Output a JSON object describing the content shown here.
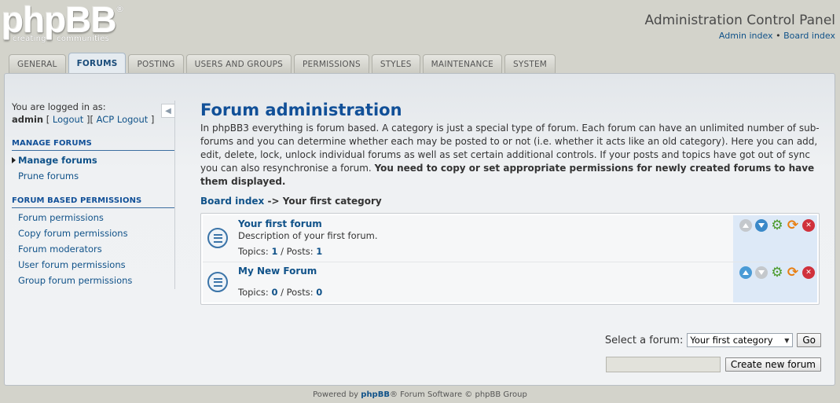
{
  "header": {
    "logo_text": "phpBB",
    "logo_reg": "®",
    "logo_tagline": "creating    communities",
    "title": "Administration Control Panel",
    "admin_index": "Admin index",
    "separator": "•",
    "board_index": "Board index"
  },
  "tabs": [
    {
      "label": "GENERAL",
      "active": false
    },
    {
      "label": "FORUMS",
      "active": true
    },
    {
      "label": "POSTING",
      "active": false
    },
    {
      "label": "USERS AND GROUPS",
      "active": false
    },
    {
      "label": "PERMISSIONS",
      "active": false
    },
    {
      "label": "STYLES",
      "active": false
    },
    {
      "label": "MAINTENANCE",
      "active": false
    },
    {
      "label": "SYSTEM",
      "active": false
    }
  ],
  "sidebar": {
    "logged_in_label": "You are logged in as:",
    "username": "admin",
    "logout": "Logout",
    "acp_logout": "ACP Logout",
    "collapse_icon": "collapse-left-icon",
    "sections": [
      {
        "heading": "MANAGE FORUMS",
        "items": [
          {
            "label": "Manage forums",
            "active": true
          },
          {
            "label": "Prune forums",
            "active": false
          }
        ]
      },
      {
        "heading": "FORUM BASED PERMISSIONS",
        "items": [
          {
            "label": "Forum permissions",
            "active": false
          },
          {
            "label": "Copy forum permissions",
            "active": false
          },
          {
            "label": "Forum moderators",
            "active": false
          },
          {
            "label": "User forum permissions",
            "active": false
          },
          {
            "label": "Group forum permissions",
            "active": false
          }
        ]
      }
    ]
  },
  "main": {
    "title": "Forum administration",
    "intro": "In phpBB3 everything is forum based. A category is just a special type of forum. Each forum can have an unlimited number of sub-forums and you can determine whether each may be posted to or not (i.e. whether it acts like an old category). Here you can add, edit, delete, lock, unlock individual forums as well as set certain additional controls. If your posts and topics have got out of sync you can also resynchronise a forum.",
    "intro_bold": "You need to copy or set appropriate permissions for newly created forums to have them displayed.",
    "breadcrumb_root": "Board index",
    "breadcrumb_arrow": "->",
    "breadcrumb_current": "Your first category",
    "forums": [
      {
        "name": "Your first forum",
        "description": "Description of your first forum.",
        "topics_label": "Topics:",
        "topics": "1",
        "posts_label": "Posts:",
        "posts": "1",
        "stats_sep": "/",
        "move_up_enabled": false,
        "move_down_enabled": true
      },
      {
        "name": "My New Forum",
        "description": "",
        "topics_label": "Topics:",
        "topics": "0",
        "posts_label": "Posts:",
        "posts": "0",
        "stats_sep": "/",
        "move_up_enabled": true,
        "move_down_enabled": false
      }
    ],
    "select_label": "Select a forum:",
    "select_value": "Your first category",
    "go_button": "Go",
    "create_input_value": "",
    "create_button": "Create new forum"
  },
  "footer": {
    "prefix": "Powered by",
    "brand": "phpBB",
    "suffix": "® Forum Software © phpBB Group"
  },
  "colors": {
    "link": "#105289",
    "accent": "#115098",
    "action_bg": "#dde9f7",
    "delete": "#d0313c",
    "sync": "#e87f12",
    "edit": "#4a9a2a"
  }
}
